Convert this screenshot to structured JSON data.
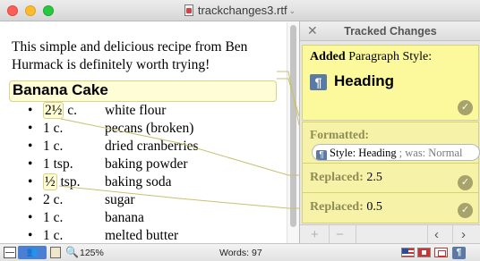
{
  "window": {
    "title": "trackchanges3.rtf",
    "title_chevron": "⌄",
    "file_icon": "rtf-file-icon"
  },
  "editor": {
    "intro_line1": "This simple and delicious recipe from Ben",
    "intro_line2": "Hurmack is definitely worth trying!",
    "heading": "Banana Cake",
    "bullet": "•",
    "ingredients": [
      {
        "qty": "2½ c.",
        "item": "white flour"
      },
      {
        "qty": "1 c.",
        "item": "pecans (broken)"
      },
      {
        "qty": "1 c.",
        "item": "dried cranberries"
      },
      {
        "qty": "1 tsp.",
        "item": "baking powder"
      },
      {
        "qty": "½ tsp.",
        "item": "baking soda"
      },
      {
        "qty": "2 c.",
        "item": "sugar"
      },
      {
        "qty": "1 c.",
        "item": "banana"
      },
      {
        "qty": "1 c.",
        "item": "melted butter"
      }
    ],
    "marked": {
      "qty0_num": "2½",
      "qty0_unit": " c.",
      "qty4_num": "½",
      "qty4_unit": " tsp."
    }
  },
  "panel": {
    "close": "✕",
    "title": "Tracked Changes",
    "changes": {
      "added": {
        "kind": "Added",
        "rest": " Paragraph Style:",
        "style": "Heading"
      },
      "formatted": {
        "kind": "Formatted:",
        "style_text": "Style: Heading",
        "was_text": "; was: Normal"
      },
      "replaced1": {
        "kind": "Replaced:",
        "value": " 2.5"
      },
      "replaced2": {
        "kind": "Replaced:",
        "value": " 0.5"
      }
    },
    "check": "✓",
    "pilcrow": "¶",
    "footer": {
      "add": "+",
      "remove": "−",
      "prev": "‹",
      "next": "›"
    }
  },
  "statusbar": {
    "zoom": "125%",
    "words": "Words: 97",
    "track_icon": "👥",
    "zoom_icon": "🔍",
    "pilcrow": "¶"
  },
  "colors": {
    "change_yellow": "#fcf99c",
    "change_border": "#d8d274",
    "accent_blue": "#4a7fd4"
  }
}
